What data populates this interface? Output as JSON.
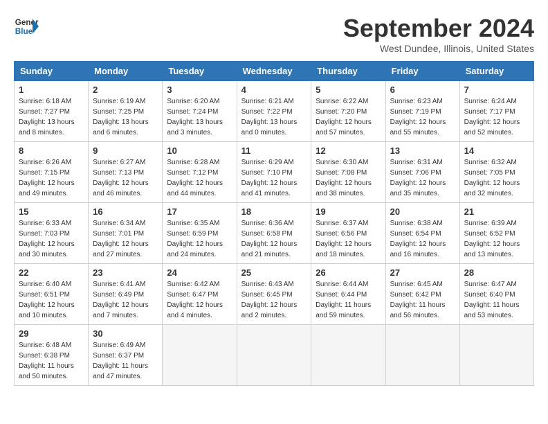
{
  "logo": {
    "line1": "General",
    "line2": "Blue"
  },
  "title": "September 2024",
  "location": "West Dundee, Illinois, United States",
  "days_of_week": [
    "Sunday",
    "Monday",
    "Tuesday",
    "Wednesday",
    "Thursday",
    "Friday",
    "Saturday"
  ],
  "weeks": [
    [
      {
        "day": "1",
        "sunrise": "6:18 AM",
        "sunset": "7:27 PM",
        "daylight": "13 hours and 8 minutes."
      },
      {
        "day": "2",
        "sunrise": "6:19 AM",
        "sunset": "7:25 PM",
        "daylight": "13 hours and 6 minutes."
      },
      {
        "day": "3",
        "sunrise": "6:20 AM",
        "sunset": "7:24 PM",
        "daylight": "13 hours and 3 minutes."
      },
      {
        "day": "4",
        "sunrise": "6:21 AM",
        "sunset": "7:22 PM",
        "daylight": "13 hours and 0 minutes."
      },
      {
        "day": "5",
        "sunrise": "6:22 AM",
        "sunset": "7:20 PM",
        "daylight": "12 hours and 57 minutes."
      },
      {
        "day": "6",
        "sunrise": "6:23 AM",
        "sunset": "7:19 PM",
        "daylight": "12 hours and 55 minutes."
      },
      {
        "day": "7",
        "sunrise": "6:24 AM",
        "sunset": "7:17 PM",
        "daylight": "12 hours and 52 minutes."
      }
    ],
    [
      {
        "day": "8",
        "sunrise": "6:26 AM",
        "sunset": "7:15 PM",
        "daylight": "12 hours and 49 minutes."
      },
      {
        "day": "9",
        "sunrise": "6:27 AM",
        "sunset": "7:13 PM",
        "daylight": "12 hours and 46 minutes."
      },
      {
        "day": "10",
        "sunrise": "6:28 AM",
        "sunset": "7:12 PM",
        "daylight": "12 hours and 44 minutes."
      },
      {
        "day": "11",
        "sunrise": "6:29 AM",
        "sunset": "7:10 PM",
        "daylight": "12 hours and 41 minutes."
      },
      {
        "day": "12",
        "sunrise": "6:30 AM",
        "sunset": "7:08 PM",
        "daylight": "12 hours and 38 minutes."
      },
      {
        "day": "13",
        "sunrise": "6:31 AM",
        "sunset": "7:06 PM",
        "daylight": "12 hours and 35 minutes."
      },
      {
        "day": "14",
        "sunrise": "6:32 AM",
        "sunset": "7:05 PM",
        "daylight": "12 hours and 32 minutes."
      }
    ],
    [
      {
        "day": "15",
        "sunrise": "6:33 AM",
        "sunset": "7:03 PM",
        "daylight": "12 hours and 30 minutes."
      },
      {
        "day": "16",
        "sunrise": "6:34 AM",
        "sunset": "7:01 PM",
        "daylight": "12 hours and 27 minutes."
      },
      {
        "day": "17",
        "sunrise": "6:35 AM",
        "sunset": "6:59 PM",
        "daylight": "12 hours and 24 minutes."
      },
      {
        "day": "18",
        "sunrise": "6:36 AM",
        "sunset": "6:58 PM",
        "daylight": "12 hours and 21 minutes."
      },
      {
        "day": "19",
        "sunrise": "6:37 AM",
        "sunset": "6:56 PM",
        "daylight": "12 hours and 18 minutes."
      },
      {
        "day": "20",
        "sunrise": "6:38 AM",
        "sunset": "6:54 PM",
        "daylight": "12 hours and 16 minutes."
      },
      {
        "day": "21",
        "sunrise": "6:39 AM",
        "sunset": "6:52 PM",
        "daylight": "12 hours and 13 minutes."
      }
    ],
    [
      {
        "day": "22",
        "sunrise": "6:40 AM",
        "sunset": "6:51 PM",
        "daylight": "12 hours and 10 minutes."
      },
      {
        "day": "23",
        "sunrise": "6:41 AM",
        "sunset": "6:49 PM",
        "daylight": "12 hours and 7 minutes."
      },
      {
        "day": "24",
        "sunrise": "6:42 AM",
        "sunset": "6:47 PM",
        "daylight": "12 hours and 4 minutes."
      },
      {
        "day": "25",
        "sunrise": "6:43 AM",
        "sunset": "6:45 PM",
        "daylight": "12 hours and 2 minutes."
      },
      {
        "day": "26",
        "sunrise": "6:44 AM",
        "sunset": "6:44 PM",
        "daylight": "11 hours and 59 minutes."
      },
      {
        "day": "27",
        "sunrise": "6:45 AM",
        "sunset": "6:42 PM",
        "daylight": "11 hours and 56 minutes."
      },
      {
        "day": "28",
        "sunrise": "6:47 AM",
        "sunset": "6:40 PM",
        "daylight": "11 hours and 53 minutes."
      }
    ],
    [
      {
        "day": "29",
        "sunrise": "6:48 AM",
        "sunset": "6:38 PM",
        "daylight": "11 hours and 50 minutes."
      },
      {
        "day": "30",
        "sunrise": "6:49 AM",
        "sunset": "6:37 PM",
        "daylight": "11 hours and 47 minutes."
      },
      null,
      null,
      null,
      null,
      null
    ]
  ]
}
